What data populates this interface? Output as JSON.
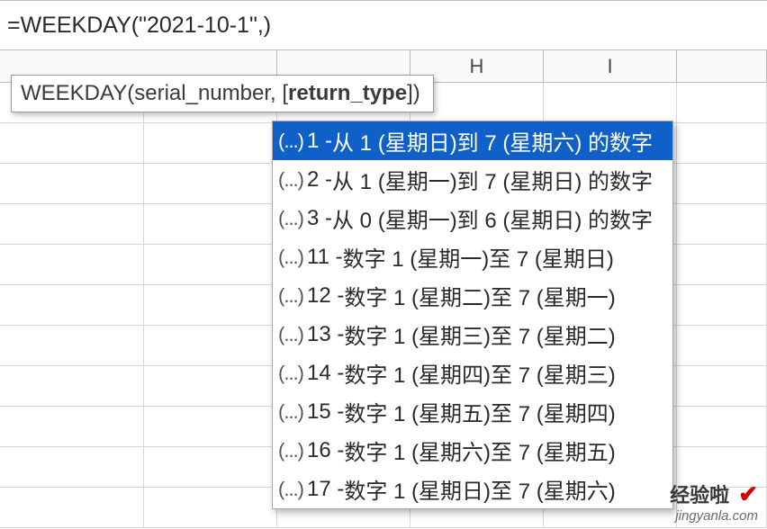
{
  "formula_bar": {
    "text": "=WEEKDAY(\"2021-10-1\",)"
  },
  "tooltip": {
    "func": "WEEKDAY",
    "arg1": "serial_number",
    "arg2_open": "[",
    "arg2": "return_type",
    "arg2_close": "]"
  },
  "column_headers": {
    "h": "H",
    "i": "I"
  },
  "autocomplete": {
    "icon": "(...)",
    "items": [
      {
        "code": "1",
        "desc": "从 1 (星期日)到 7 (星期六) 的数字",
        "selected": true
      },
      {
        "code": "2",
        "desc": "从 1 (星期一)到 7 (星期日) 的数字",
        "selected": false
      },
      {
        "code": "3",
        "desc": "从 0 (星期一)到 6 (星期日) 的数字",
        "selected": false
      },
      {
        "code": "11",
        "desc": "数字 1 (星期一)至 7 (星期日)",
        "selected": false
      },
      {
        "code": "12",
        "desc": "数字 1 (星期二)至 7 (星期一)",
        "selected": false
      },
      {
        "code": "13",
        "desc": "数字 1 (星期三)至 7 (星期二)",
        "selected": false
      },
      {
        "code": "14",
        "desc": "数字 1 (星期四)至 7 (星期三)",
        "selected": false
      },
      {
        "code": "15",
        "desc": "数字 1 (星期五)至 7 (星期四)",
        "selected": false
      },
      {
        "code": "16",
        "desc": "数字 1 (星期六)至 7 (星期五)",
        "selected": false
      },
      {
        "code": "17",
        "desc": "数字 1 (星期日)至 7 (星期六)",
        "selected": false
      }
    ]
  },
  "watermark": {
    "line1": "经验啦",
    "line2": "jingyanla.com"
  }
}
